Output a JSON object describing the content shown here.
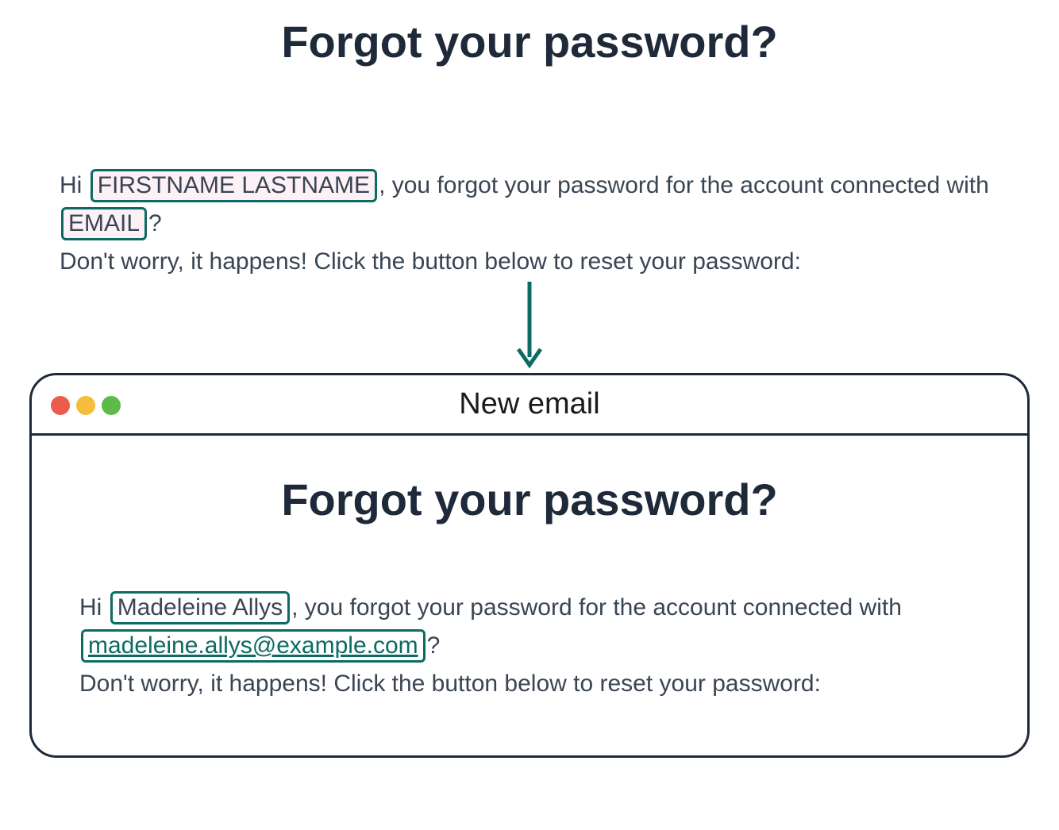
{
  "template": {
    "heading": "Forgot your password?",
    "line_prefix": "Hi",
    "placeholder_name": "FIRSTNAME LASTNAME",
    "after_name": ", you forgot your password for the account connected with",
    "placeholder_email": "EMAIL",
    "after_email": "?",
    "line2": "Don't worry, it happens! Click the button below to reset your password:"
  },
  "window": {
    "title": "New email"
  },
  "rendered": {
    "heading": "Forgot your password?",
    "line_prefix": "Hi",
    "name": "Madeleine Allys",
    "after_name": ", you forgot your password for the account connected with",
    "email": "madeleine.allys@example.com",
    "after_email": "?",
    "line2": "Don't worry, it happens! Click the button below to reset your password:"
  }
}
